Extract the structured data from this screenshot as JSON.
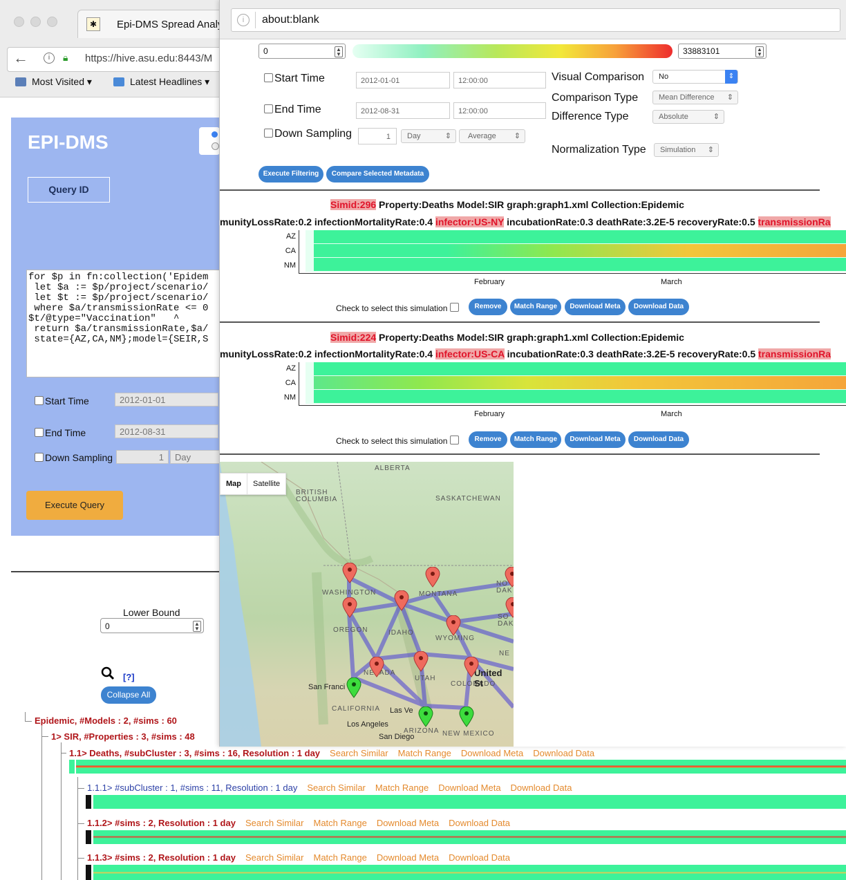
{
  "background_browser": {
    "tab_title": "Epi-DMS Spread Analy",
    "url": "https://hive.asu.edu:8443/M",
    "bookmarks": [
      "Most Visited",
      "Latest Headlines"
    ]
  },
  "left_panel": {
    "title": "EPI-DMS",
    "query_id_button": "Query ID",
    "query_text": "for $p in fn:collection('Epidem\n let $a := $p/project/scenario/\n let $t := $p/project/scenario/\n where $a/transmissionRate <= 0\n$t/@type=\"Vaccination\"   ^\n return $a/transmissionRate,$a/\n state={AZ,CA,NM};model={SEIR,S",
    "start_time_label": "Start Time",
    "start_time_value": "2012-01-01",
    "end_time_label": "End Time",
    "end_time_value": "2012-08-31",
    "down_sampling_label": "Down Sampling",
    "down_sampling_value": "1",
    "down_sampling_unit": "Day",
    "execute_button": "Execute Query",
    "lower_bound_label": "Lower Bound",
    "lower_bound_value": "0",
    "help_link": "[?]",
    "collapse_all": "Collapse All"
  },
  "tree": {
    "root": "Epidemic, #Models : 2, #sims : 60",
    "model": "1> SIR, #Properties : 3, #sims : 48",
    "property": "1.1> Deaths, #subCluster : 3, #sims : 16, Resolution : 1 day",
    "sub1_prefix": "1.1.1> ",
    "sub1_rest": "#subCluster : 1, #sims : 11, Resolution : 1 day",
    "sub2": "1.1.2> #sims : 2, Resolution : 1 day",
    "sub3": "1.1.3> #sims : 2, Resolution : 1 day",
    "actions": [
      "Search Similar",
      "Match Range",
      "Download Meta",
      "Download Data"
    ]
  },
  "popup": {
    "url": "about:blank",
    "range_min": "0",
    "range_max": "33883101",
    "start_time_label": "Start Time",
    "start_date": "2012-01-01",
    "start_clock": "12:00:00",
    "end_time_label": "End Time",
    "end_date": "2012-08-31",
    "end_clock": "12:00:00",
    "down_sampling_label": "Down Sampling",
    "down_sampling_value": "1",
    "down_sampling_unit": "Day",
    "down_sampling_agg": "Average",
    "visual_comparison_label": "Visual Comparison",
    "visual_comparison_value": "No",
    "comparison_type_label": "Comparison Type",
    "comparison_type_value": "Mean Difference",
    "difference_type_label": "Difference Type",
    "difference_type_value": "Absolute",
    "normalization_type_label": "Normalization Type",
    "normalization_type_value": "Simulation",
    "execute_filtering": "Execute Filtering",
    "compare_metadata": "Compare Selected Metadata"
  },
  "simulations": [
    {
      "simid": "Simid:296",
      "title_rest": " Property:Deaths Model:SIR graph:graph1.xml Collection:Epidemic",
      "params_pre": "munityLossRate:0.2 infectionMortalityRate:0.4 ",
      "infector": "infector:US-NY",
      "params_post": " incubationRate:0.3 deathRate:3.2E-5 recoveryRate:0.5 ",
      "transmission": "transmissionRa",
      "states": [
        "AZ",
        "CA",
        "NM"
      ],
      "months": [
        "February",
        "March"
      ],
      "check_label": "Check to select this simulation",
      "buttons": [
        "Remove",
        "Match Range",
        "Download Meta",
        "Download Data"
      ]
    },
    {
      "simid": "Simid:224",
      "title_rest": " Property:Deaths Model:SIR graph:graph1.xml Collection:Epidemic",
      "params_pre": "munityLossRate:0.2 infectionMortalityRate:0.4 ",
      "infector": "infector:US-CA",
      "params_post": " incubationRate:0.3 deathRate:3.2E-5 recoveryRate:0.5 ",
      "transmission": "transmissionRa",
      "states": [
        "AZ",
        "CA",
        "NM"
      ],
      "months": [
        "February",
        "March"
      ],
      "check_label": "Check to select this simulation",
      "buttons": [
        "Remove",
        "Match Range",
        "Download Meta",
        "Download Data"
      ]
    }
  ],
  "map": {
    "type_buttons": [
      "Map",
      "Satellite"
    ],
    "region_labels": [
      "ALBERTA",
      "BRITISH COLUMBIA",
      "SASKATCHEWAN",
      "WASHINGTON",
      "MONTANA",
      "NO DAK",
      "OREGON",
      "IDAHO",
      "WYOMING",
      "SO DAK",
      "NEVADA",
      "UTAH",
      "COLORADO",
      "NE",
      "CALIFORNIA",
      "ARIZONA",
      "NEW MEXICO",
      "United St"
    ],
    "city_labels": [
      "San Franci",
      "Los Angeles",
      "Las Ve",
      "San Diego"
    ]
  },
  "colors": {
    "panel_blue": "#9db6f0",
    "button_blue": "#3d83d0",
    "execute_orange": "#f0ac3f",
    "tree_red": "#b0161a",
    "action_orange": "#e48a2d",
    "heat_low": "#3df29a",
    "heat_high": "#ee2d2d"
  }
}
